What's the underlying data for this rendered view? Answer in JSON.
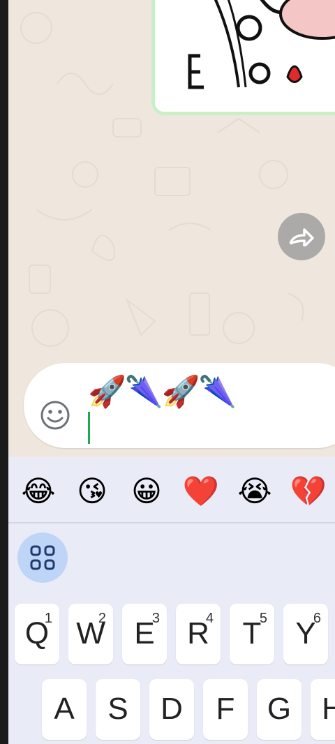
{
  "chat": {
    "message_input_value": "🚀🌂🚀🌂",
    "forward_icon": "forward-icon",
    "emoji_icon": "smiley-face-icon"
  },
  "keyboard": {
    "suggested_emojis": [
      "😂",
      "😘",
      "😀",
      "❤️",
      "😭",
      "💔"
    ],
    "grid_icon": "apps-grid-icon",
    "row1": [
      {
        "letter": "Q",
        "num": "1"
      },
      {
        "letter": "W",
        "num": "2"
      },
      {
        "letter": "E",
        "num": "3"
      },
      {
        "letter": "R",
        "num": "4"
      },
      {
        "letter": "T",
        "num": "5"
      },
      {
        "letter": "Y",
        "num": "6"
      }
    ],
    "row2": [
      "A",
      "S",
      "D",
      "F",
      "G",
      "H"
    ]
  }
}
